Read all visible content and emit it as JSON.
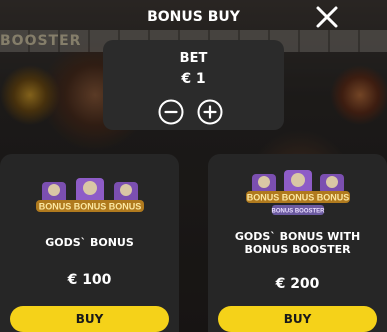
{
  "dialog": {
    "title": "BONUS BUY",
    "close_icon": "close-icon"
  },
  "background": {
    "booster_text": "BOOSTER"
  },
  "bet": {
    "label": "BET",
    "value": "€ 1",
    "decrease_icon": "minus-circle-icon",
    "increase_icon": "plus-circle-icon"
  },
  "offers": [
    {
      "name": "GODS` BONUS",
      "price": "€ 100",
      "buy_label": "BUY",
      "logo_text": "BONUS BONUS BONUS"
    },
    {
      "name_line1": "GODS` BONUS WITH",
      "name_line2": "BONUS BOOSTER",
      "price": "€ 200",
      "buy_label": "BUY",
      "logo_text": "BONUS BONUS BONUS",
      "logo_subtext": "BONUS BOOSTER"
    }
  ],
  "colors": {
    "buy_button": "#f5d219",
    "card_bg": "#262626",
    "panel_bg": "#2b2b2b",
    "text": "#ffffff"
  }
}
